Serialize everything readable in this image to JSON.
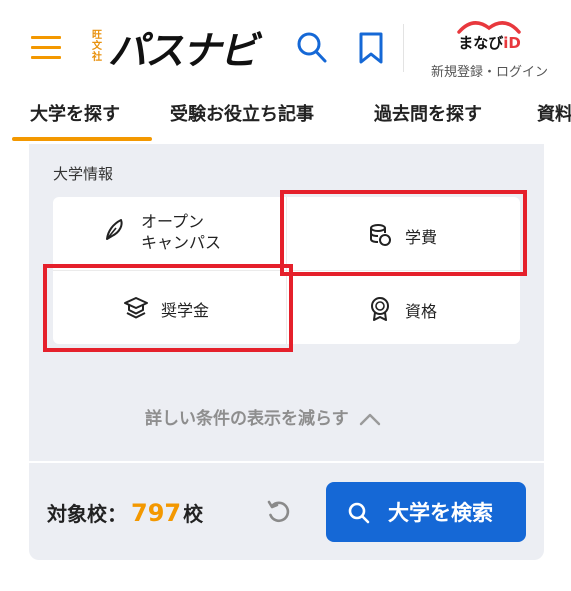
{
  "header": {
    "logo_sub": "旺文社",
    "logo_main": "パスナビ",
    "manabi_brand": "まなび",
    "manabi_id": "iD",
    "manabi_link": "新規登録・ログイン"
  },
  "tabs": [
    {
      "label": "大学を探す"
    },
    {
      "label": "受験お役立ち記事"
    },
    {
      "label": "過去問を探す"
    },
    {
      "label": "資料"
    }
  ],
  "filters": {
    "section_label": "大学情報",
    "items": [
      {
        "label_line1": "オープン",
        "label_line2": "キャンパス",
        "icon": "pen-icon"
      },
      {
        "label": "学費",
        "icon": "coins-icon"
      },
      {
        "label": "奨学金",
        "icon": "graduation-cap-icon"
      },
      {
        "label": "資格",
        "icon": "award-badge-icon"
      }
    ],
    "collapse_label": "詳しい条件の表示を減らす"
  },
  "footer": {
    "count_label": "対象校：",
    "count_value": "797",
    "count_unit": "校",
    "search_label": "大学を検索"
  },
  "colors": {
    "accent": "#f39800",
    "primary": "#1568d6",
    "highlight": "#e5202b",
    "panel": "#eceef3"
  }
}
